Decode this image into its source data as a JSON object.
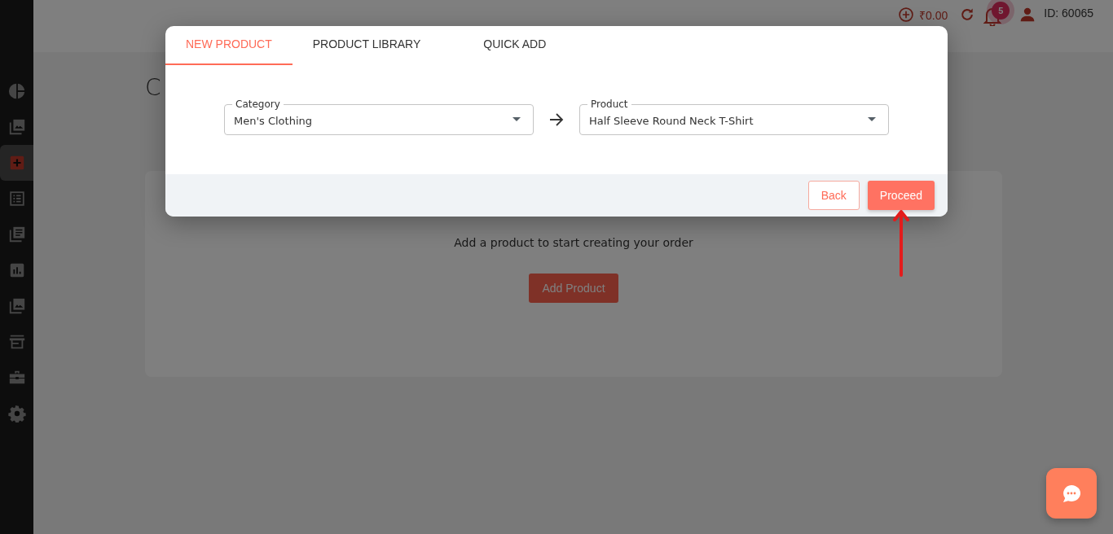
{
  "sidebar": {
    "items": [
      {
        "kind": "pie",
        "selected": false
      },
      {
        "kind": "gallery",
        "selected": false
      },
      {
        "kind": "plus",
        "selected": true
      },
      {
        "kind": "list",
        "selected": false
      },
      {
        "kind": "library",
        "selected": false
      },
      {
        "kind": "chart",
        "selected": false
      },
      {
        "kind": "gallery",
        "selected": false
      },
      {
        "kind": "store",
        "selected": false
      },
      {
        "kind": "briefcase",
        "selected": false
      },
      {
        "kind": "gear",
        "selected": false
      }
    ]
  },
  "header": {
    "balance": "₹0.00",
    "notification_count": "5",
    "user_id": "ID: 60065"
  },
  "page": {
    "title": "C",
    "empty_message": "Add a product to start creating your order",
    "add_button": "Add Product"
  },
  "modal": {
    "tabs": [
      {
        "label": "NEW PRODUCT",
        "selected": true
      },
      {
        "label": "PRODUCT LIBRARY",
        "selected": false
      },
      {
        "label": "QUICK ADD",
        "selected": false
      }
    ],
    "fields": [
      {
        "label": "Category",
        "value": "Men's Clothing"
      },
      {
        "label": "Product",
        "value": "Half Sleeve Round Neck T-Shirt"
      }
    ],
    "buttons": [
      {
        "label": "Back",
        "kind": "outline"
      },
      {
        "label": "Proceed",
        "kind": "primary"
      }
    ]
  }
}
